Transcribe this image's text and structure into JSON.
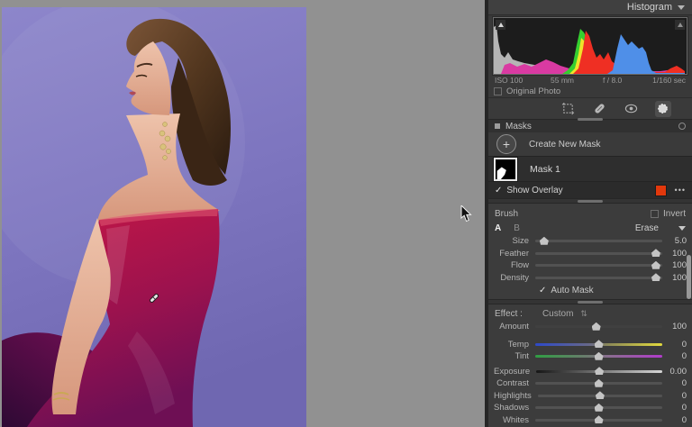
{
  "panel": {
    "histogram": {
      "header": "Histogram",
      "exif": {
        "iso": "ISO 100",
        "focal": "55 mm",
        "aperture": "f / 8.0",
        "shutter": "1/160 sec"
      },
      "original_photo_label": "Original Photo",
      "channels": [
        "gray",
        "red",
        "green",
        "blue",
        "magenta",
        "yellow"
      ]
    },
    "toolstrip": {
      "tools": [
        {
          "name": "crop-tool-icon",
          "active": false
        },
        {
          "name": "healing-tool-icon",
          "active": false
        },
        {
          "name": "red-eye-tool-icon",
          "active": false
        },
        {
          "name": "masking-tool-icon",
          "active": true
        }
      ]
    },
    "masks": {
      "header": "Masks",
      "create_label": "Create New Mask",
      "items": [
        {
          "label": "Mask 1"
        }
      ],
      "show_overlay_label": "Show Overlay",
      "show_overlay_checked": true,
      "overlay_color": "#e2380c",
      "overlay_swatch_style": "background:#e2380c",
      "more_label": "•••",
      "check_glyph": "✓",
      "plus_glyph": "+"
    },
    "brush": {
      "header": "Brush",
      "invert_label": "Invert",
      "a": "A",
      "b": "B",
      "erase": "Erase",
      "sliders": [
        {
          "label": "Size",
          "value": "5.0"
        },
        {
          "label": "Feather",
          "value": "100"
        },
        {
          "label": "Flow",
          "value": "100"
        },
        {
          "label": "Density",
          "value": "100"
        }
      ],
      "auto_mask_label": "Auto Mask",
      "auto_mask_checked": true,
      "check_glyph": "✓"
    },
    "effect": {
      "label": "Effect :",
      "preset": "Custom",
      "updown_glyph": "⇅",
      "sliders": [
        {
          "label": "Amount",
          "value": "100"
        },
        {
          "label": "Temp",
          "value": "0"
        },
        {
          "label": "Tint",
          "value": "0"
        },
        {
          "label": "Exposure",
          "value": "0.00"
        },
        {
          "label": "Contrast",
          "value": "0"
        },
        {
          "label": "Highlights",
          "value": "0"
        },
        {
          "label": "Shadows",
          "value": "0"
        },
        {
          "label": "Whites",
          "value": "0"
        }
      ]
    }
  }
}
